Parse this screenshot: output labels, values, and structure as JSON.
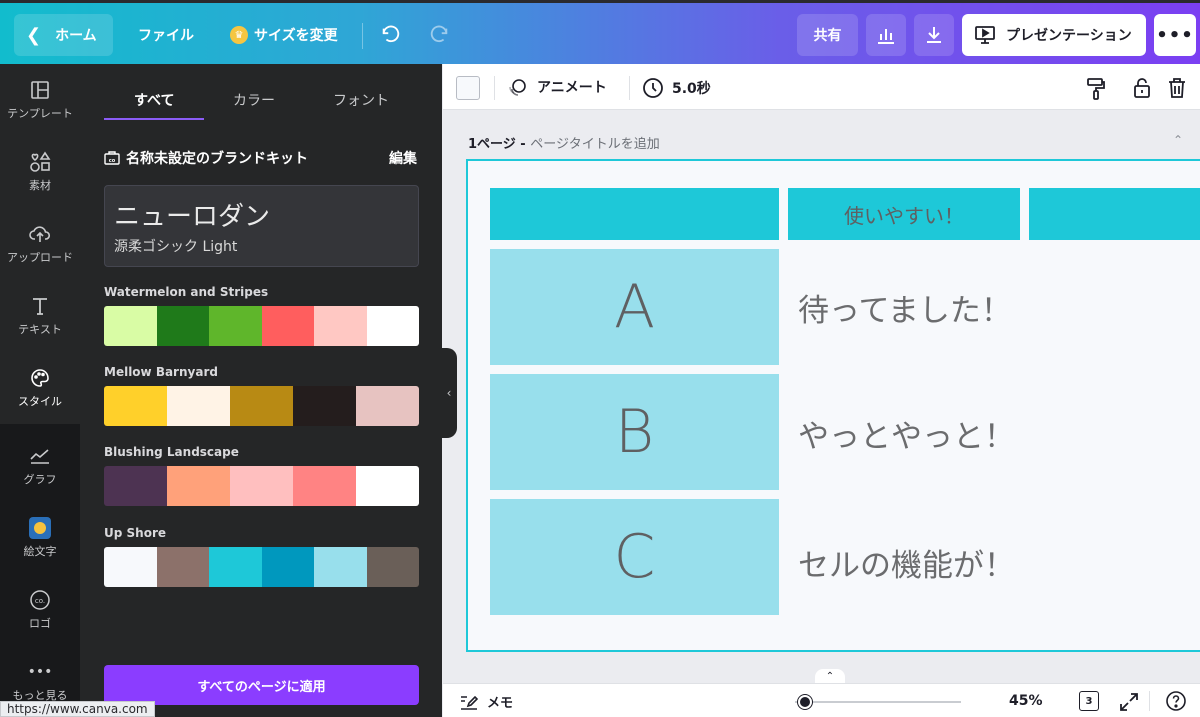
{
  "topbar": {
    "home": "ホーム",
    "file": "ファイル",
    "resize": "サイズを変更",
    "share": "共有",
    "present": "プレゼンテーション"
  },
  "rail": {
    "items": [
      {
        "label": "テンプレート"
      },
      {
        "label": "素材"
      },
      {
        "label": "アップロード"
      },
      {
        "label": "テキスト"
      },
      {
        "label": "スタイル"
      },
      {
        "label": "グラフ"
      },
      {
        "label": "絵文字"
      },
      {
        "label": "ロゴ"
      },
      {
        "label": "もっと見る"
      }
    ]
  },
  "panel": {
    "tabs": [
      "すべて",
      "カラー",
      "フォント"
    ],
    "brandkit_title": "名称未設定のブランドキット",
    "edit": "編集",
    "font_heading": "ニューロダン",
    "font_body": "源柔ゴシック Light",
    "palettes": [
      {
        "name": "Watermelon and Stripes",
        "colors": [
          "#d9fca5",
          "#1f7a1a",
          "#5fb62b",
          "#ff5e5e",
          "#ffc8c3",
          "#ffffff"
        ]
      },
      {
        "name": "Mellow Barnyard",
        "colors": [
          "#ffd02a",
          "#fff3e6",
          "#b88a14",
          "#241d1d",
          "#e7c3c1"
        ]
      },
      {
        "name": "Blushing Landscape",
        "colors": [
          "#4d3352",
          "#ffa17a",
          "#ffbfbf",
          "#ff8383",
          "#ffffff"
        ]
      },
      {
        "name": "Up Shore",
        "colors": [
          "#f7f9fc",
          "#8c716a",
          "#1ec8d8",
          "#0098be",
          "#98dfec",
          "#6a5f58"
        ]
      }
    ],
    "apply_button": "すべてのページに適用"
  },
  "toolbar": {
    "animate": "アニメート",
    "duration": "5.0秒"
  },
  "canvas": {
    "page_label": "1ページ - ",
    "page_title_placeholder": "ページタイトルを追加",
    "header_text": "使いやすい！",
    "rows": [
      {
        "letter": "A",
        "text": "待ってました！"
      },
      {
        "letter": "B",
        "text": "やっとやっと！"
      },
      {
        "letter": "C",
        "text": "セルの機能が！"
      }
    ]
  },
  "bottom": {
    "notes": "メモ",
    "zoom": "45%",
    "page_count": "3"
  },
  "status_url": "https://www.canva.com"
}
